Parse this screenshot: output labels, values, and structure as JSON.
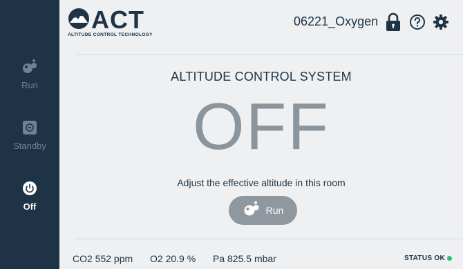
{
  "sidebar": {
    "items": [
      {
        "label": "Run",
        "icon": "run-bubbles-icon",
        "active": false
      },
      {
        "label": "Standby",
        "icon": "standby-icon",
        "active": false
      },
      {
        "label": "Off",
        "icon": "power-icon",
        "active": true
      }
    ]
  },
  "header": {
    "logo_text": "ACT",
    "logo_subtitle": "ALTITUDE CONTROL TECHNOLOGY",
    "room_name": "06221_Oxygen",
    "icons": [
      "lock-icon",
      "help-icon",
      "gear-icon"
    ]
  },
  "main": {
    "title": "ALTITUDE CONTROL SYSTEM",
    "state": "OFF",
    "subtitle": "Adjust the effective altitude in this room",
    "run_button_label": "Run"
  },
  "footer": {
    "co2": "CO2  552 ppm",
    "o2": "O2  20.9 %",
    "pa": "Pa  825.5 mbar",
    "status": "STATUS  OK",
    "status_color": "#2fbf71"
  },
  "colors": {
    "sidebar_bg": "#1e3345",
    "page_bg": "#eef0f1",
    "accent_text": "#1e3345",
    "muted": "#8a959e",
    "button_bg": "#8f989f"
  }
}
